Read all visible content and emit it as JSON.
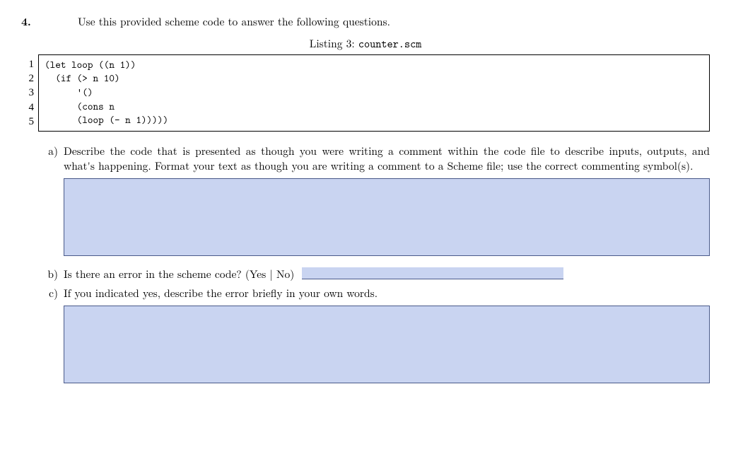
{
  "question": {
    "number": "4.",
    "prompt": "Use this provided scheme code to answer the following questions."
  },
  "listing": {
    "caption_prefix": "Listing 3: ",
    "filename": "counter.scm",
    "line_numbers": [
      "1",
      "2",
      "3",
      "4",
      "5"
    ],
    "code": "(let loop ((n 1))\n  (if (> n 10)\n      '()\n      (cons n\n      (loop (- n 1)))))"
  },
  "parts": {
    "a": {
      "label": "a)",
      "text": "Describe the code that is presented as though you were writing a comment within the code file to describe inputs, outputs, and what's happening. Format your text as though you are writing a comment to a Scheme file; use the correct commenting symbol(s)."
    },
    "b": {
      "label": "b)",
      "text": "Is there an error in the scheme code? (Yes | No)"
    },
    "c": {
      "label": "c)",
      "text": "If you indicated yes, describe the error briefly in your own words."
    }
  }
}
